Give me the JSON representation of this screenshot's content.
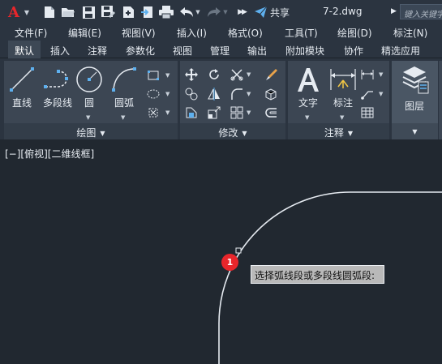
{
  "titlebar": {
    "share_label": "共享",
    "file_name": "7-2.dwg",
    "search_placeholder": "键入关键字"
  },
  "menu": [
    "文件(F)",
    "编辑(E)",
    "视图(V)",
    "插入(I)",
    "格式(O)",
    "工具(T)",
    "绘图(D)",
    "标注(N)"
  ],
  "tabs": [
    "默认",
    "插入",
    "注释",
    "参数化",
    "视图",
    "管理",
    "输出",
    "附加模块",
    "协作",
    "精选应用"
  ],
  "ribbon": {
    "draw": {
      "title": "绘图",
      "tools": [
        "直线",
        "多段线",
        "圆",
        "圆弧"
      ]
    },
    "modify": {
      "title": "修改"
    },
    "annotation": {
      "title": "注释",
      "tools": [
        "文字",
        "标注"
      ]
    },
    "layers": {
      "label": "图层"
    }
  },
  "viewport": {
    "label": "[−][俯视][二维线框]",
    "step_number": "1",
    "prompt": "选择弧线段或多段线圆弧段:"
  },
  "colors": {
    "accent_red": "#e8262b",
    "share_blue": "#5eb0ee",
    "canvas_bg": "#212830"
  }
}
